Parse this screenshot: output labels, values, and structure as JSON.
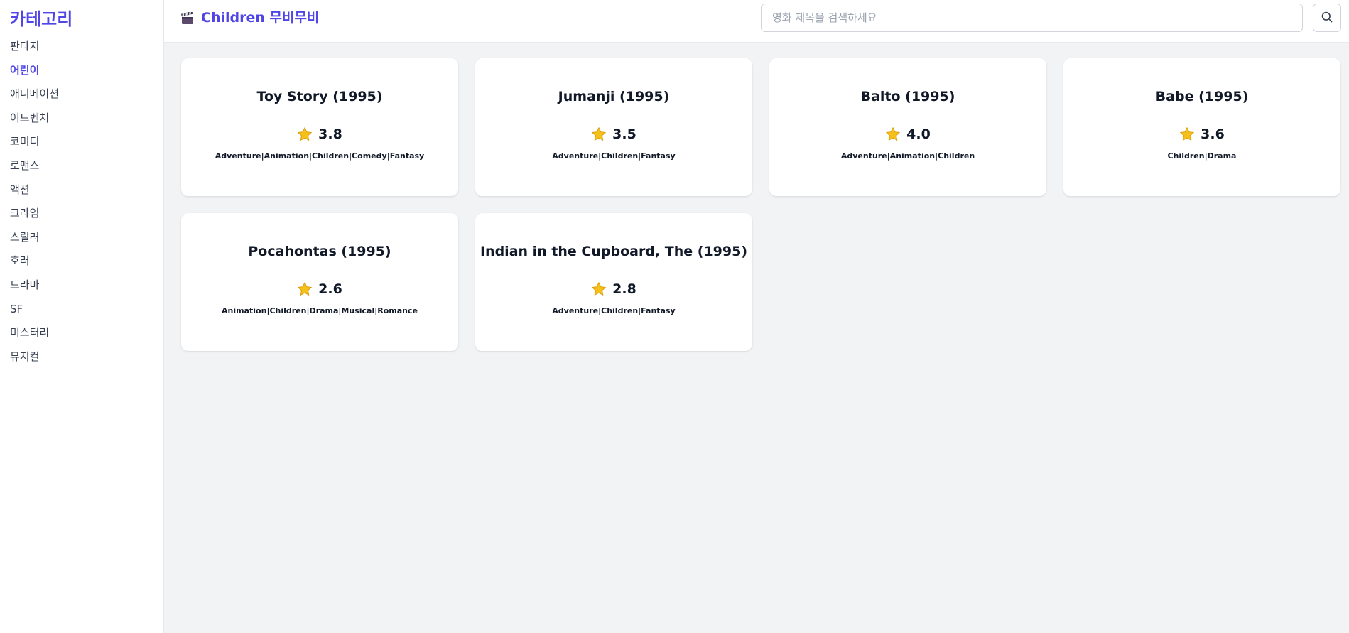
{
  "sidebar": {
    "title": "카테고리",
    "items": [
      {
        "label": "판타지",
        "active": false
      },
      {
        "label": "어린이",
        "active": true
      },
      {
        "label": "애니메이션",
        "active": false
      },
      {
        "label": "어드벤처",
        "active": false
      },
      {
        "label": "코미디",
        "active": false
      },
      {
        "label": "로맨스",
        "active": false
      },
      {
        "label": "액션",
        "active": false
      },
      {
        "label": "크라임",
        "active": false
      },
      {
        "label": "스릴러",
        "active": false
      },
      {
        "label": "호러",
        "active": false
      },
      {
        "label": "드라마",
        "active": false
      },
      {
        "label": "SF",
        "active": false
      },
      {
        "label": "미스터리",
        "active": false
      },
      {
        "label": "뮤지컬",
        "active": false
      }
    ]
  },
  "header": {
    "title": "Children 무비무비",
    "title_icon": "clapperboard-icon",
    "search": {
      "placeholder": "영화 제목을 검색하세요",
      "value": ""
    },
    "search_button_icon": "search-icon"
  },
  "movies": [
    {
      "title": "Toy Story (1995)",
      "rating": "3.8",
      "genres": "Adventure|Animation|Children|Comedy|Fantasy"
    },
    {
      "title": "Jumanji (1995)",
      "rating": "3.5",
      "genres": "Adventure|Children|Fantasy"
    },
    {
      "title": "Balto (1995)",
      "rating": "4.0",
      "genres": "Adventure|Animation|Children"
    },
    {
      "title": "Babe (1995)",
      "rating": "3.6",
      "genres": "Children|Drama"
    },
    {
      "title": "Pocahontas (1995)",
      "rating": "2.6",
      "genres": "Animation|Children|Drama|Musical|Romance"
    },
    {
      "title": "Indian in the Cupboard, The (1995)",
      "rating": "2.8",
      "genres": "Adventure|Children|Fantasy"
    }
  ],
  "colors": {
    "accent": "#4f46e5",
    "star": "#f5c01a",
    "background": "#f2f3f5"
  }
}
